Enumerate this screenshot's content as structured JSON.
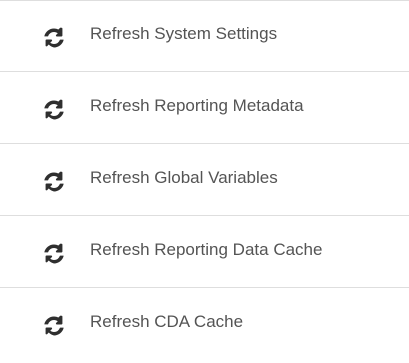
{
  "refresh_menu": {
    "items": [
      {
        "label": "Refresh System Settings",
        "icon": "refresh-icon"
      },
      {
        "label": "Refresh Reporting Metadata",
        "icon": "refresh-icon"
      },
      {
        "label": "Refresh Global Variables",
        "icon": "refresh-icon"
      },
      {
        "label": "Refresh Reporting Data Cache",
        "icon": "refresh-icon"
      },
      {
        "label": "Refresh CDA Cache",
        "icon": "refresh-icon"
      }
    ]
  },
  "colors": {
    "text": "#545454",
    "icon": "#2f2f2f",
    "divider": "#dedede",
    "background": "#ffffff"
  }
}
